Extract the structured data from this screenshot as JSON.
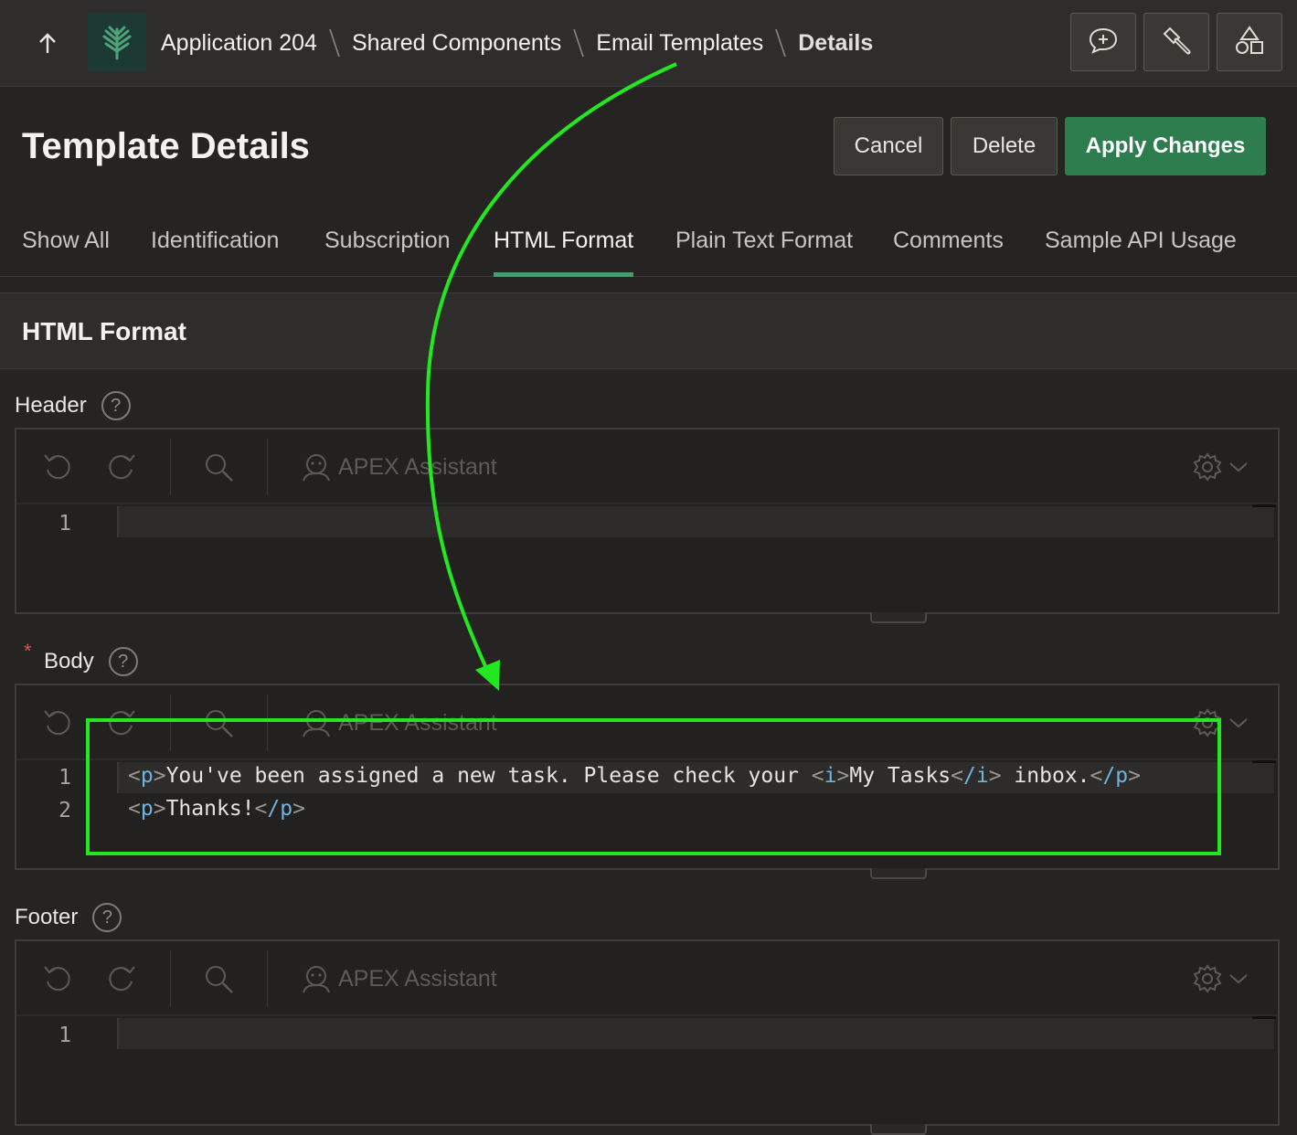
{
  "breadcrumb": {
    "items": [
      "Application 204",
      "Shared Components",
      "Email Templates"
    ],
    "current": "Details"
  },
  "page": {
    "title": "Template Details",
    "buttons": {
      "cancel": "Cancel",
      "delete": "Delete",
      "apply": "Apply Changes"
    }
  },
  "tabs": [
    "Show All",
    "Identification",
    "Subscription",
    "HTML Format",
    "Plain Text Format",
    "Comments",
    "Sample API Usage"
  ],
  "active_tab": "HTML Format",
  "region": {
    "title": "HTML Format"
  },
  "fields": {
    "header": {
      "label": "Header",
      "help": "?",
      "lines": [
        "1"
      ]
    },
    "body": {
      "label": "Body",
      "required_marker": "*",
      "help": "?",
      "lines": [
        "1",
        "2"
      ],
      "code": {
        "line1": {
          "open_p": "p",
          "text1": "You've been assigned a new task. Please check your ",
          "open_i": "i",
          "text2": "My Tasks",
          "close_i": "/i",
          "text3": " inbox.",
          "close_p": "/p"
        },
        "line2": {
          "open_p": "p",
          "text1": "Thanks!",
          "close_p": "/p"
        }
      }
    },
    "footer": {
      "label": "Footer",
      "help": "?",
      "lines": [
        "1"
      ]
    }
  },
  "editor": {
    "assistant_label": "APEX Assistant"
  },
  "colors": {
    "accent_green": "#2e7d4f",
    "annotation_green": "#22e81f",
    "tag_blue": "#6fb3e0"
  }
}
